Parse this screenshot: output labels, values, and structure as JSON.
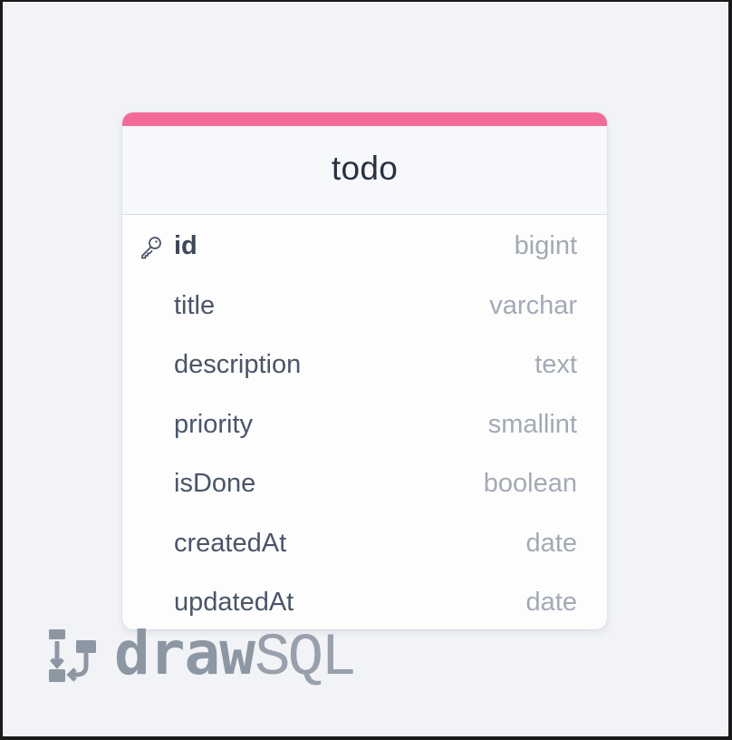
{
  "colors": {
    "accent": "#f26b96",
    "header_bg": "#f6f8fb",
    "card_bg": "#fdfdfe",
    "canvas_bg": "#f1f3f6",
    "column_name": "#4a5568",
    "column_type": "#a3aab5",
    "brand": "#8d97a4"
  },
  "table": {
    "name": "todo",
    "columns": [
      {
        "name": "id",
        "type": "bigint",
        "primary_key": true,
        "icon": "key-icon"
      },
      {
        "name": "title",
        "type": "varchar",
        "primary_key": false
      },
      {
        "name": "description",
        "type": "text",
        "primary_key": false
      },
      {
        "name": "priority",
        "type": "smallint",
        "primary_key": false
      },
      {
        "name": "isDone",
        "type": "boolean",
        "primary_key": false
      },
      {
        "name": "createdAt",
        "type": "date",
        "primary_key": false
      },
      {
        "name": "updatedAt",
        "type": "date",
        "primary_key": false
      }
    ]
  },
  "branding": {
    "icon": "drawsql-logo-icon",
    "name_part1": "draw",
    "name_part2": "SQL"
  }
}
